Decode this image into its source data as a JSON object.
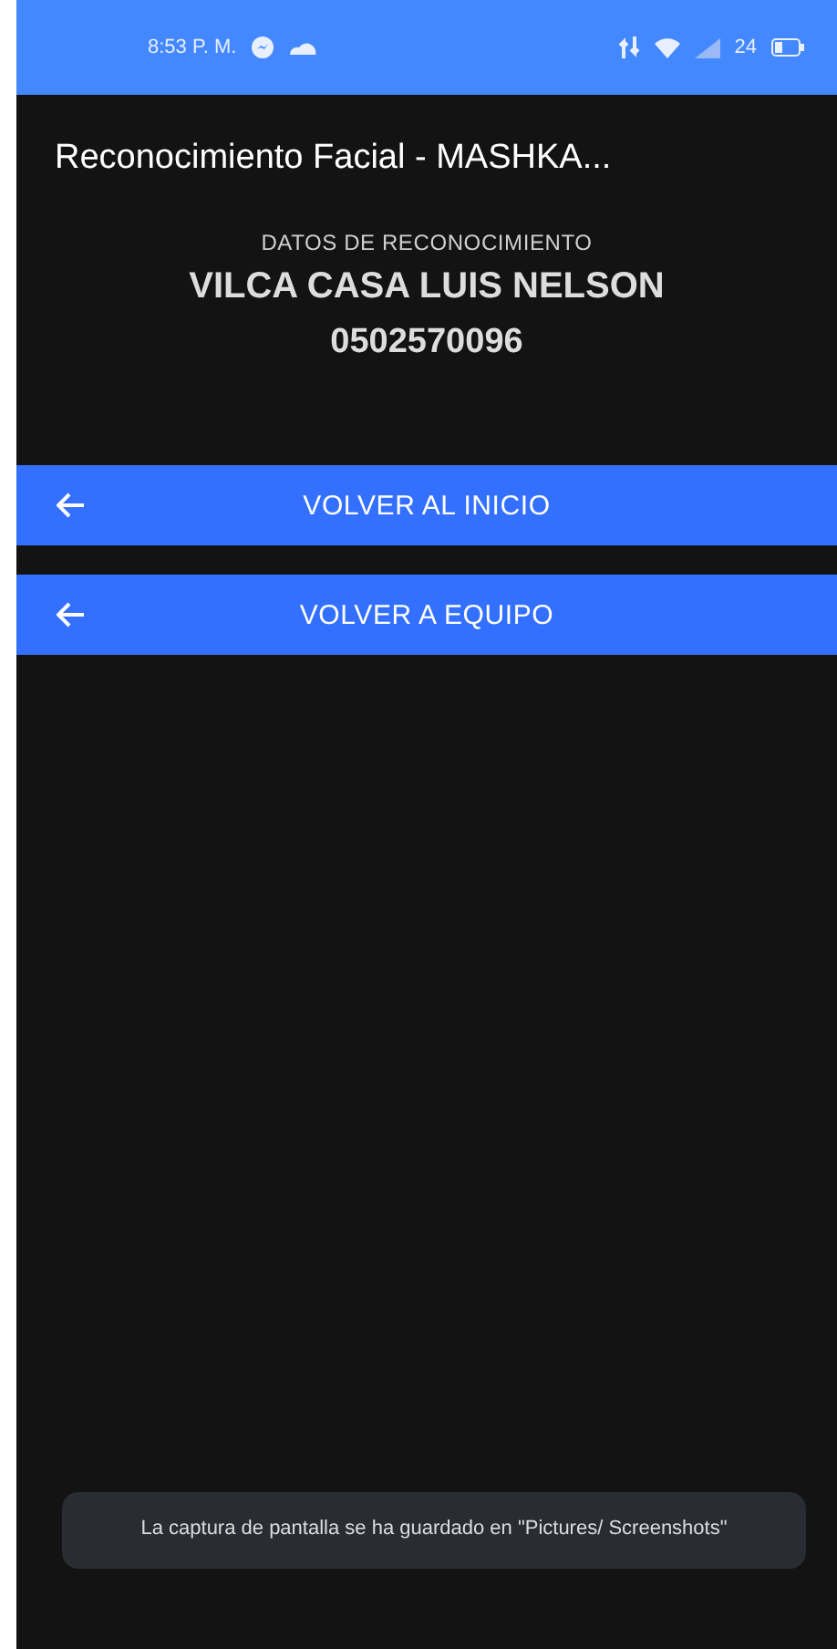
{
  "status_bar": {
    "time": "8:53 P. M.",
    "battery": "24"
  },
  "title": "Reconocimiento Facial - MASHKA...",
  "recognition": {
    "label": "DATOS DE RECONOCIMIENTO",
    "name": "VILCA CASA LUIS NELSON",
    "id_number": "0502570096"
  },
  "buttons": [
    {
      "label": "VOLVER AL INICIO"
    },
    {
      "label": "VOLVER A EQUIPO"
    }
  ],
  "toast": "La captura de pantalla se ha guardado en \"Pictures/ Screenshots\""
}
